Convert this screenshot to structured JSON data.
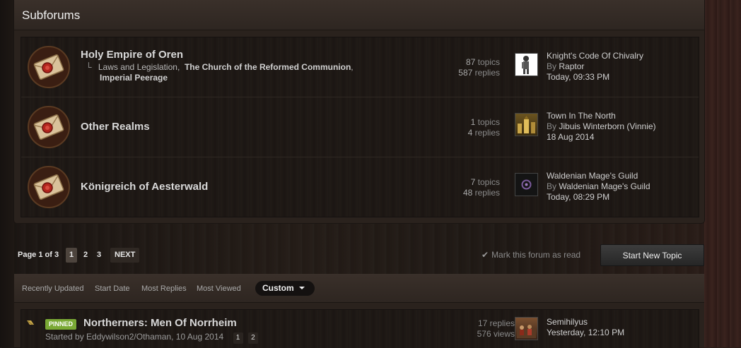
{
  "subforums": {
    "title": "Subforums",
    "forums": [
      {
        "name": "Holy Empire of Oren",
        "subcategories": [
          "Laws and Legislation",
          "The Church of the Reformed Communion",
          "Imperial Peerage"
        ],
        "topics_count": "87",
        "topics_label": "topics",
        "replies_count": "587",
        "replies_label": "replies",
        "last_post": {
          "title": "Knight's Code Of Chivalry",
          "by_label": "By",
          "author": "Raptor",
          "date": "Today, 09:33 PM"
        }
      },
      {
        "name": "Other Realms",
        "subcategories": [],
        "topics_count": "1",
        "topics_label": "topics",
        "replies_count": "4",
        "replies_label": "replies",
        "last_post": {
          "title": "Town In The North",
          "by_label": "By",
          "author": "Jibuis Winterborn (Vinnie)",
          "date": "18 Aug 2014"
        }
      },
      {
        "name": "Königreich of Aesterwald",
        "subcategories": [],
        "topics_count": "7",
        "topics_label": "topics",
        "replies_count": "48",
        "replies_label": "replies",
        "last_post": {
          "title": "Waldenian Mage's Guild",
          "by_label": "By",
          "author": "Waldenian Mage's Guild",
          "date": "Today, 08:29 PM"
        }
      }
    ]
  },
  "pagination": {
    "label": "Page 1 of 3",
    "pages": [
      "1",
      "2",
      "3"
    ],
    "current": "1",
    "next": "NEXT"
  },
  "actions": {
    "mark_read": "Mark this forum as read",
    "start_topic": "Start New Topic"
  },
  "sort": {
    "tabs": [
      "Recently Updated",
      "Start Date",
      "Most Replies",
      "Most Viewed"
    ],
    "active": "Custom"
  },
  "topics": [
    {
      "badge": "PINNED",
      "title": "Northerners: Men Of Norrheim",
      "started_by": "Started by Eddywilson2/Othaman, 10 Aug 2014",
      "pages": [
        "1",
        "2"
      ],
      "replies": "17 replies",
      "views": "576 views",
      "last_author": "Semihilyus",
      "last_date": "Yesterday, 12:10 PM"
    }
  ],
  "colors": {
    "pinned_badge": "#7aa935",
    "background": "#1f1915",
    "panel": "#2a221d"
  },
  "icons": {
    "forum_icon": "envelope-seal-icon",
    "checkmark": "checkmark-icon",
    "pin": "pin-icon",
    "dropdown": "caret-down-icon"
  }
}
